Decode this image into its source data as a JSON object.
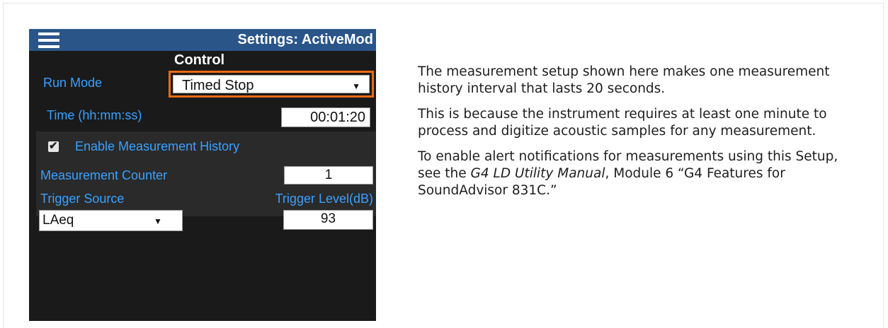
{
  "device": {
    "header_title": "Settings: ActiveMod",
    "section_title": "Control",
    "run_mode": {
      "label": "Run Mode",
      "value": "Timed Stop"
    },
    "time": {
      "label": "Time (hh:mm:ss)",
      "value": "00:01:20"
    },
    "history": {
      "label": "Enable Measurement History",
      "checked": true
    },
    "counter": {
      "label": "Measurement Counter",
      "value": "1"
    },
    "trigger_source": {
      "label": "Trigger Source",
      "value": "LAeq"
    },
    "trigger_level": {
      "label": "Trigger Level(dB)",
      "value": "93"
    },
    "dropdown_glyph": "▼",
    "check_glyph": "✔"
  },
  "colors": {
    "header_bg": "#2a5589",
    "label_blue": "#3aa0ff",
    "highlight_orange": "#ec6b12",
    "device_bg": "#1a1a1a"
  },
  "description": {
    "p1": "The measurement setup shown here makes one measurement history interval that lasts 20 seconds.",
    "p2": "This is because the instrument requires at least one minute to process and digitize acoustic samples for any measurement.",
    "p3_before": "To enable alert notifications for measurements using this Setup, see the ",
    "p3_italic": "G4 LD Utility Manual",
    "p3_after": ", Module 6 “G4 Features for SoundAdvisor 831C.”"
  }
}
